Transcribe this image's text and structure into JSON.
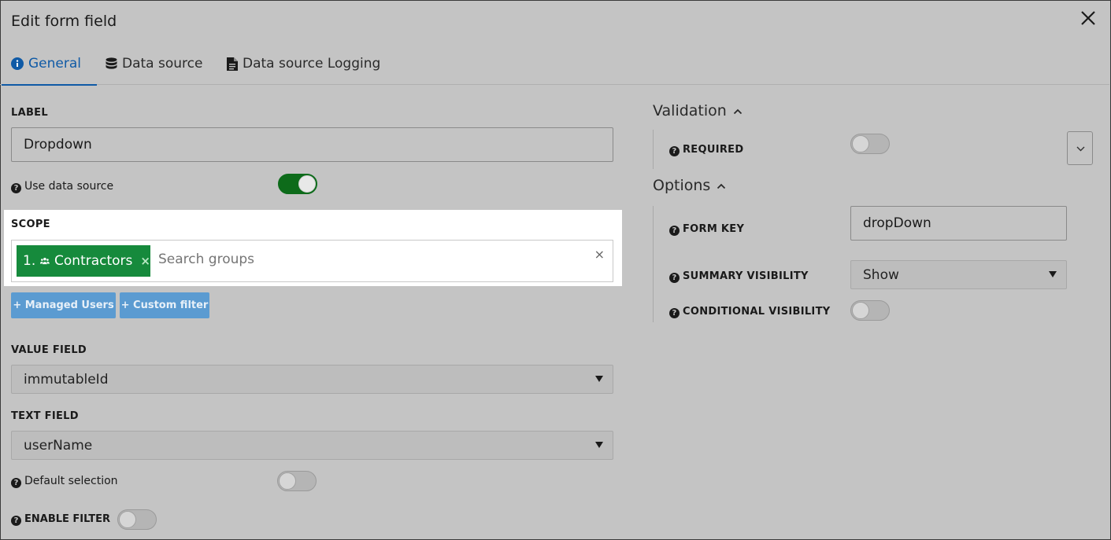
{
  "dialog": {
    "title": "Edit form field"
  },
  "tabs": [
    {
      "label": "General",
      "icon": "info-circle-icon",
      "active": true
    },
    {
      "label": "Data source",
      "icon": "database-icon",
      "active": false
    },
    {
      "label": "Data source Logging",
      "icon": "document-icon",
      "active": false
    }
  ],
  "left": {
    "label_heading": "LABEL",
    "label_value": "Dropdown",
    "use_data_source": {
      "label": "Use data source",
      "on": true
    },
    "scope": {
      "heading": "SCOPE",
      "chip_label": "1. 👥 Contractors",
      "chip_number": "1.",
      "chip_text": "Contractors",
      "chip_remove": "×",
      "search_placeholder": "Search groups",
      "clear": "×"
    },
    "buttons": {
      "managed_users": "+ Managed Users",
      "custom_filter": "+ Custom filter"
    },
    "value_field": {
      "heading": "VALUE FIELD",
      "selected": "immutableId"
    },
    "text_field": {
      "heading": "TEXT FIELD",
      "selected": "userName"
    },
    "default_selection": {
      "label": "Default selection",
      "on": false
    },
    "enable_filter": {
      "label": "ENABLE FILTER",
      "on": false
    }
  },
  "right": {
    "validation": {
      "heading": "Validation",
      "required": {
        "label": "REQUIRED",
        "on": false
      }
    },
    "options": {
      "heading": "Options",
      "form_key": {
        "label": "FORM KEY",
        "value": "dropDown"
      },
      "summary_visibility": {
        "label": "SUMMARY VISIBILITY",
        "selected": "Show"
      },
      "conditional_visibility": {
        "label": "CONDITIONAL VISIBILITY",
        "on": false
      }
    }
  },
  "colors": {
    "accent": "#0f5aa6",
    "chip": "#168a3c",
    "toggle_on": "#0d6b1a",
    "button_blue": "#5b9bd1"
  }
}
